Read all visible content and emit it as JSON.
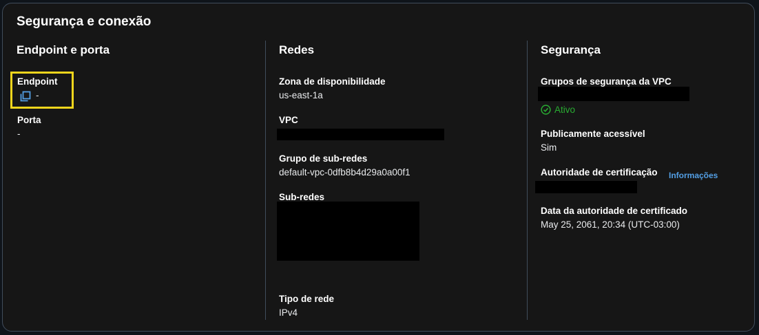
{
  "panel": {
    "title": "Segurança e conexão"
  },
  "columns": {
    "endpoint_port": {
      "title": "Endpoint e porta",
      "endpoint_label": "Endpoint",
      "endpoint_value": "-",
      "port_label": "Porta",
      "port_value": "-"
    },
    "networks": {
      "title": "Redes",
      "az_label": "Zona de disponibilidade",
      "az_value": "us-east-1a",
      "vpc_label": "VPC",
      "subnet_group_label": "Grupo de sub-redes",
      "subnet_group_value": "default-vpc-0dfb8b4d29a0a00f1",
      "subnets_label": "Sub-redes",
      "network_type_label": "Tipo de rede",
      "network_type_value": "IPv4"
    },
    "security": {
      "title": "Segurança",
      "sg_label": "Grupos de segurança da VPC",
      "sg_status": "Ativo",
      "public_label": "Publicamente acessível",
      "public_value": "Sim",
      "ca_label": "Autoridade de certificação",
      "ca_info_link": "Informações",
      "ca_date_label": "Data da autoridade de certificado",
      "ca_date_value": "May 25, 2061, 20:34 (UTC-03:00)"
    }
  },
  "icons": {
    "copy": "copy-icon",
    "status": "check-circle-icon"
  },
  "colors": {
    "accent": "#539fe5",
    "success": "#29ad32",
    "highlight": "#f2d51c"
  }
}
